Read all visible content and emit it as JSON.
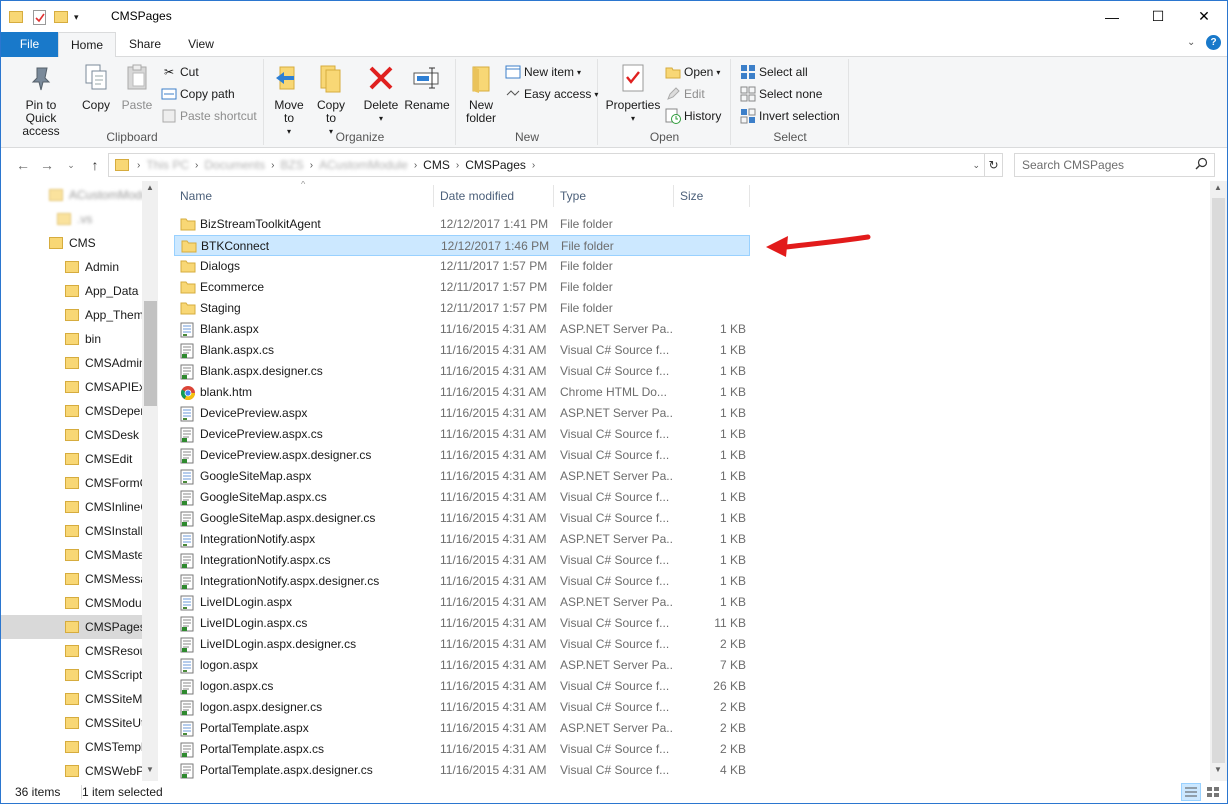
{
  "window": {
    "title": "CMSPages"
  },
  "tabs": [
    {
      "label": "File",
      "name": "tab-file"
    },
    {
      "label": "Home",
      "name": "tab-home"
    },
    {
      "label": "Share",
      "name": "tab-share"
    },
    {
      "label": "View",
      "name": "tab-view"
    }
  ],
  "ribbon": {
    "clipboard": {
      "label": "Clipboard",
      "pin": "Pin to Quick access",
      "copy": "Copy",
      "paste": "Paste",
      "cut": "Cut",
      "copy_path": "Copy path",
      "paste_shortcut": "Paste shortcut"
    },
    "organize": {
      "label": "Organize",
      "move_to": "Move to",
      "copy_to": "Copy to",
      "delete": "Delete",
      "rename": "Rename"
    },
    "new": {
      "label": "New",
      "new_folder": "New folder",
      "new_item": "New item",
      "easy_access": "Easy access"
    },
    "open": {
      "label": "Open",
      "properties": "Properties",
      "open": "Open",
      "edit": "Edit",
      "history": "History"
    },
    "select": {
      "label": "Select",
      "select_all": "Select all",
      "select_none": "Select none",
      "invert": "Invert selection"
    }
  },
  "address": {
    "crumbs": [
      "This PC",
      "Documents",
      "BZS",
      "ACustomModule",
      "CMS",
      "CMSPages"
    ],
    "search_placeholder": "Search CMSPages"
  },
  "nav": {
    "items": [
      {
        "label": "ACustomModule",
        "blur": true
      },
      {
        "label": ".vs",
        "blur": true
      },
      {
        "label": "CMS"
      },
      {
        "label": "Admin"
      },
      {
        "label": "App_Data"
      },
      {
        "label": "App_Themes"
      },
      {
        "label": "bin"
      },
      {
        "label": "CMSAdminControls"
      },
      {
        "label": "CMSAPIExamples"
      },
      {
        "label": "CMSDependencies"
      },
      {
        "label": "CMSDesk"
      },
      {
        "label": "CMSEdit"
      },
      {
        "label": "CMSFormControls"
      },
      {
        "label": "CMSInlineControls"
      },
      {
        "label": "CMSInstall"
      },
      {
        "label": "CMSMasterPages"
      },
      {
        "label": "CMSMessages"
      },
      {
        "label": "CMSModules"
      },
      {
        "label": "CMSPages",
        "selected": true
      },
      {
        "label": "CMSResources"
      },
      {
        "label": "CMSScripts"
      },
      {
        "label": "CMSSiteManager"
      },
      {
        "label": "CMSSiteUtils"
      },
      {
        "label": "CMSTemplates"
      },
      {
        "label": "CMSWebParts"
      }
    ]
  },
  "columns": {
    "name": "Name",
    "date": "Date modified",
    "type": "Type",
    "size": "Size"
  },
  "files": [
    {
      "name": "BizStreamToolkitAgent",
      "date": "12/12/2017 1:41 PM",
      "type": "File folder",
      "size": "",
      "icon": "folder"
    },
    {
      "name": "BTKConnect",
      "date": "12/12/2017 1:46 PM",
      "type": "File folder",
      "size": "",
      "icon": "folder",
      "selected": true
    },
    {
      "name": "Dialogs",
      "date": "12/11/2017 1:57 PM",
      "type": "File folder",
      "size": "",
      "icon": "folder"
    },
    {
      "name": "Ecommerce",
      "date": "12/11/2017 1:57 PM",
      "type": "File folder",
      "size": "",
      "icon": "folder"
    },
    {
      "name": "Staging",
      "date": "12/11/2017 1:57 PM",
      "type": "File folder",
      "size": "",
      "icon": "folder"
    },
    {
      "name": "Blank.aspx",
      "date": "11/16/2015 4:31 AM",
      "type": "ASP.NET Server Pa...",
      "size": "1 KB",
      "icon": "aspx"
    },
    {
      "name": "Blank.aspx.cs",
      "date": "11/16/2015 4:31 AM",
      "type": "Visual C# Source f...",
      "size": "1 KB",
      "icon": "cs"
    },
    {
      "name": "Blank.aspx.designer.cs",
      "date": "11/16/2015 4:31 AM",
      "type": "Visual C# Source f...",
      "size": "1 KB",
      "icon": "cs"
    },
    {
      "name": "blank.htm",
      "date": "11/16/2015 4:31 AM",
      "type": "Chrome HTML Do...",
      "size": "1 KB",
      "icon": "chrome"
    },
    {
      "name": "DevicePreview.aspx",
      "date": "11/16/2015 4:31 AM",
      "type": "ASP.NET Server Pa...",
      "size": "1 KB",
      "icon": "aspx"
    },
    {
      "name": "DevicePreview.aspx.cs",
      "date": "11/16/2015 4:31 AM",
      "type": "Visual C# Source f...",
      "size": "1 KB",
      "icon": "cs"
    },
    {
      "name": "DevicePreview.aspx.designer.cs",
      "date": "11/16/2015 4:31 AM",
      "type": "Visual C# Source f...",
      "size": "1 KB",
      "icon": "cs"
    },
    {
      "name": "GoogleSiteMap.aspx",
      "date": "11/16/2015 4:31 AM",
      "type": "ASP.NET Server Pa...",
      "size": "1 KB",
      "icon": "aspx"
    },
    {
      "name": "GoogleSiteMap.aspx.cs",
      "date": "11/16/2015 4:31 AM",
      "type": "Visual C# Source f...",
      "size": "1 KB",
      "icon": "cs"
    },
    {
      "name": "GoogleSiteMap.aspx.designer.cs",
      "date": "11/16/2015 4:31 AM",
      "type": "Visual C# Source f...",
      "size": "1 KB",
      "icon": "cs"
    },
    {
      "name": "IntegrationNotify.aspx",
      "date": "11/16/2015 4:31 AM",
      "type": "ASP.NET Server Pa...",
      "size": "1 KB",
      "icon": "aspx"
    },
    {
      "name": "IntegrationNotify.aspx.cs",
      "date": "11/16/2015 4:31 AM",
      "type": "Visual C# Source f...",
      "size": "1 KB",
      "icon": "cs"
    },
    {
      "name": "IntegrationNotify.aspx.designer.cs",
      "date": "11/16/2015 4:31 AM",
      "type": "Visual C# Source f...",
      "size": "1 KB",
      "icon": "cs"
    },
    {
      "name": "LiveIDLogin.aspx",
      "date": "11/16/2015 4:31 AM",
      "type": "ASP.NET Server Pa...",
      "size": "1 KB",
      "icon": "aspx"
    },
    {
      "name": "LiveIDLogin.aspx.cs",
      "date": "11/16/2015 4:31 AM",
      "type": "Visual C# Source f...",
      "size": "11 KB",
      "icon": "cs"
    },
    {
      "name": "LiveIDLogin.aspx.designer.cs",
      "date": "11/16/2015 4:31 AM",
      "type": "Visual C# Source f...",
      "size": "2 KB",
      "icon": "cs"
    },
    {
      "name": "logon.aspx",
      "date": "11/16/2015 4:31 AM",
      "type": "ASP.NET Server Pa...",
      "size": "7 KB",
      "icon": "aspx"
    },
    {
      "name": "logon.aspx.cs",
      "date": "11/16/2015 4:31 AM",
      "type": "Visual C# Source f...",
      "size": "26 KB",
      "icon": "cs"
    },
    {
      "name": "logon.aspx.designer.cs",
      "date": "11/16/2015 4:31 AM",
      "type": "Visual C# Source f...",
      "size": "2 KB",
      "icon": "cs"
    },
    {
      "name": "PortalTemplate.aspx",
      "date": "11/16/2015 4:31 AM",
      "type": "ASP.NET Server Pa...",
      "size": "2 KB",
      "icon": "aspx"
    },
    {
      "name": "PortalTemplate.aspx.cs",
      "date": "11/16/2015 4:31 AM",
      "type": "Visual C# Source f...",
      "size": "2 KB",
      "icon": "cs"
    },
    {
      "name": "PortalTemplate.aspx.designer.cs",
      "date": "11/16/2015 4:31 AM",
      "type": "Visual C# Source f...",
      "size": "4 KB",
      "icon": "cs"
    }
  ],
  "status": {
    "count": "36 items",
    "selected": "1 item selected"
  },
  "colors": {
    "accent": "#1979ca",
    "selection": "#cce8ff",
    "arrow": "#e21b1b",
    "folder": "#f8d775"
  }
}
